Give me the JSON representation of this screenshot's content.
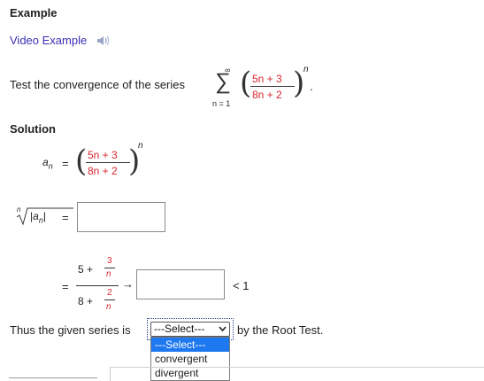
{
  "header": {
    "title": "Example"
  },
  "video": {
    "label": "Video Example",
    "icon": "speaker-icon"
  },
  "problem": {
    "text": "Test the convergence of the series",
    "sum_upper": "∞",
    "sum_lower": "n = 1",
    "numerator": "5n + 3",
    "denominator": "8n + 2",
    "exponent": "n",
    "period": "."
  },
  "solution": {
    "heading": "Solution",
    "an_label": "a",
    "an_sub": "n",
    "equals": "=",
    "numerator": "5n + 3",
    "denominator": "8n + 2",
    "exponent": "n",
    "root_index": "n",
    "abs_a": "a",
    "abs_sub": "n",
    "input1_value": "",
    "limit_num_prefix": "5 +",
    "limit_num_frac_top": "3",
    "limit_num_frac_bot": "n",
    "limit_den_prefix": "8 +",
    "limit_den_frac_top": "2",
    "limit_den_frac_bot": "n",
    "arrow": "→",
    "input2_value": "",
    "less_than": "< 1",
    "conclusion_prefix": "Thus the given series is",
    "conclusion_suffix": "by the Root Test."
  },
  "select": {
    "selected": "---Select---",
    "options": [
      "---Select---",
      "convergent",
      "divergent"
    ]
  },
  "colors": {
    "link": "#3b2fb4",
    "red": "#d8262f",
    "highlight": "#1e78f0"
  }
}
